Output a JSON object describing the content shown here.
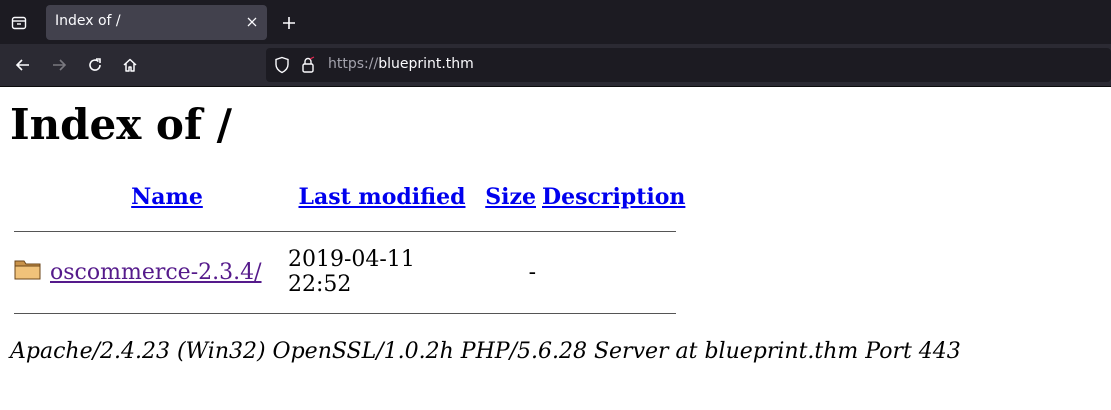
{
  "browser": {
    "tab_title": "Index of /",
    "url_scheme": "https://",
    "url_host": "blueprint.thm"
  },
  "page": {
    "heading": "Index of /",
    "columns": {
      "name": "Name",
      "last_modified": "Last modified",
      "size": "Size",
      "description": "Description"
    },
    "rows": [
      {
        "icon": "folder-icon",
        "name": "oscommerce-2.3.4/",
        "last_modified": "2019-04-11 22:52",
        "size": "-",
        "description": ""
      }
    ],
    "footer": "Apache/2.4.23 (Win32) OpenSSL/1.0.2h PHP/5.6.28 Server at blueprint.thm Port 443"
  },
  "colors": {
    "tabbar": "#1c1b22",
    "navbar": "#2b2a33",
    "link": "#0000ee",
    "visited_link": "#551a8b"
  }
}
